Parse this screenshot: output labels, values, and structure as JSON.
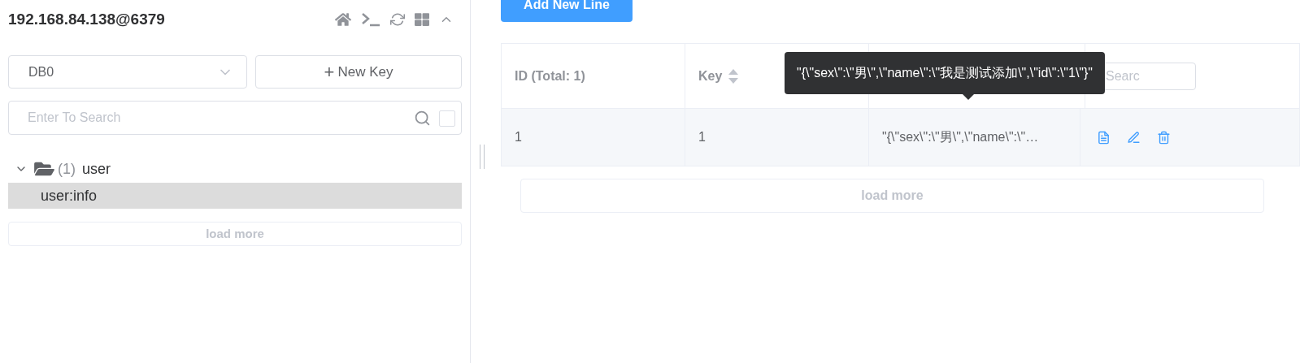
{
  "sidebar": {
    "connection_title": "192.168.84.138@6379",
    "db_select": {
      "value": "DB0"
    },
    "new_key_button": {
      "icon": "+",
      "label": "New Key"
    },
    "search": {
      "placeholder": "Enter To Search",
      "exact_checked": false
    },
    "tree": [
      {
        "label": "user",
        "count": "(1)",
        "expanded": true,
        "children": [
          {
            "label": "user:info",
            "selected": true
          }
        ]
      }
    ],
    "load_more": "load more"
  },
  "main": {
    "add_button": "Add New Line",
    "table": {
      "columns": [
        {
          "label": "ID (Total: 1)",
          "sortable": false
        },
        {
          "label": "Key",
          "sortable": true
        }
      ],
      "column_search": {
        "placeholder": "Searc"
      },
      "rows": [
        {
          "id": "1",
          "key": "1",
          "value": "\"{\\\"sex\\\":\\\"男\\\",\\\"name\\\":\\\"…"
        }
      ]
    },
    "tooltip": "\"{\\\"sex\\\":\\\"男\\\",\\\"name\\\":\\\"我是测试添加\\\",\\\"id\\\":\\\"1\\\"}\"",
    "load_more": "load more"
  }
}
